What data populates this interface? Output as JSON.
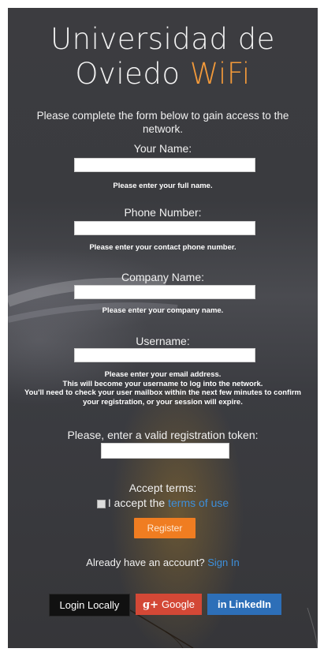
{
  "header": {
    "title_line1": "Universidad de",
    "title_line2": "Oviedo",
    "title_accent": "WiFi"
  },
  "intro": "Please complete the form below to gain access to the network.",
  "fields": [
    {
      "label": "Your Name:",
      "value": "",
      "hint": "Please enter your full name."
    },
    {
      "label": "Phone Number:",
      "value": "",
      "hint": "Please enter your contact phone number."
    },
    {
      "label": "Company Name:",
      "value": "",
      "hint": "Please enter your company name."
    },
    {
      "label": "Username:",
      "value": "",
      "hint_lines": [
        "Please enter your email address.",
        "This will become your username to log into the network.",
        "You'll need to check your user mailbox within the next few minutes to confirm",
        "your registration, or your session will expire."
      ]
    }
  ],
  "token": {
    "label": "Please, enter a valid registration token:",
    "value": ""
  },
  "terms": {
    "title": "Accept terms:",
    "checkbox_text": "I accept the",
    "link_text": "terms of use"
  },
  "register_label": "Register",
  "account": {
    "question": "Already have an account?",
    "sign_in": "Sign In"
  },
  "social": {
    "local": "Login Locally",
    "google_icon": "g+",
    "google": "Google",
    "linkedin_icon": "in",
    "linkedin": "LinkedIn"
  },
  "colors": {
    "accent": "#f39a3a",
    "register": "#f07d21",
    "link": "#3d8fdb",
    "google": "#d34836",
    "linkedin": "#2d6fb8"
  }
}
